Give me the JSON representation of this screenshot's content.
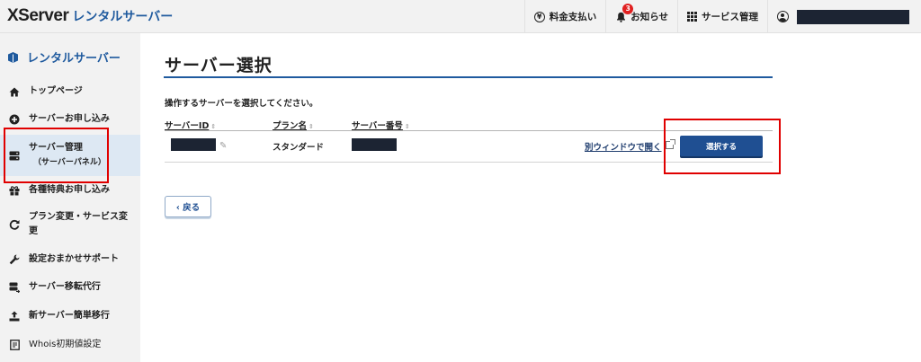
{
  "header": {
    "logo_main": "XServer",
    "logo_sub": "レンタルサーバー",
    "nav": {
      "payment_label": "料金支払い",
      "payment_icon": "yen-icon",
      "notice_label": "お知らせ",
      "notice_badge": "3",
      "notice_icon": "bell-icon",
      "services_label": "サービス管理",
      "services_icon": "grid-icon",
      "user_icon": "user-icon"
    }
  },
  "sidebar": {
    "title": "レンタルサーバー",
    "items": [
      {
        "label": "トップページ",
        "icon": "home-icon"
      },
      {
        "label": "サーバーお申し込み",
        "icon": "plus-circle-icon"
      },
      {
        "label": "サーバー管理",
        "sub": "（サーバーパネル）",
        "icon": "server-icon",
        "active": true
      },
      {
        "label": "各種特典お申し込み",
        "icon": "gift-icon"
      },
      {
        "label_line1": "プラン変更・サービス変",
        "label_line2": "更",
        "icon": "refresh-icon"
      },
      {
        "label": "設定おまかせサポート",
        "icon": "wrench-icon"
      },
      {
        "label": "サーバー移転代行",
        "icon": "server-move-icon"
      },
      {
        "label": "新サーバー簡単移行",
        "icon": "upload-icon"
      },
      {
        "label": "Whois初期値設定",
        "icon": "document-icon"
      }
    ]
  },
  "main": {
    "title": "サーバー選択",
    "instruction": "操作するサーバーを選択してください。",
    "table": {
      "headers": [
        "サーバーID",
        "プラン名",
        "サーバー番号"
      ],
      "sort_glyph": "⇕",
      "rows": [
        {
          "plan": "スタンダード",
          "open_link": "別ウィンドウで開く",
          "select_label": "選択する"
        }
      ]
    },
    "back_label": "‹ 戻る"
  },
  "colors": {
    "accent": "#1f5a9e",
    "button": "#1f4f92",
    "highlight_box": "#e00000",
    "sidebar_bg": "#f2f2f2",
    "active_bg": "#dde8f3"
  }
}
